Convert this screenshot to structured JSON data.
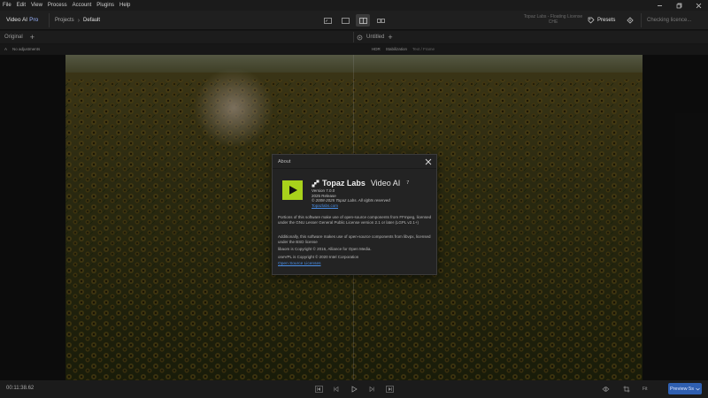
{
  "menu": [
    "File",
    "Edit",
    "View",
    "Process",
    "Account",
    "Plugins",
    "Help"
  ],
  "window_controls": {
    "minimize": "minimize-icon",
    "restore": "restore-icon",
    "close": "close-icon"
  },
  "app": {
    "name": "Video AI",
    "tier": "Pro"
  },
  "breadcrumb": {
    "root": "Projects",
    "current": "Default"
  },
  "view_modes": [
    "single-view-icon",
    "full-view-icon",
    "split-view-icon",
    "side-by-side-icon"
  ],
  "view_active": 2,
  "license_status": "Topaz Labs - Floating License\nCHE",
  "presets_label": "Presets",
  "checking_label": "Checking licence...",
  "left_panel": {
    "tab": "Original"
  },
  "right_panel": {
    "tab": "Untitled"
  },
  "info_left": {
    "a": "A",
    "adjustments": "No adjustments"
  },
  "info_right": {
    "hdr": "HDR",
    "stabilization": "Stabilization",
    "detail": "Text / Frame"
  },
  "about": {
    "title": "About",
    "brand": "Topaz Labs",
    "product": "Video AI",
    "major": "7",
    "version": "Version 7.0.0",
    "release": "2025 Release",
    "copyright": "© 2008-2025 Topaz Labs. All rights reserved",
    "site": "Topazlabs.com",
    "ffmpeg": "Portions of this software make use of open-source components from FFmpeg, licensed under the GNU Lesser General Public License version 2.1 or later (LGPL v2.1+)",
    "libvpx": "Additionally, this software makes use of open-source components from libvpx, licensed under the BSD license",
    "libaom": "libaom is Copyright © 2016, Alliance for Open Media.",
    "onevpl": "oneVPL is Copyright © 2020 Intel Corporation",
    "oss_link": "Open Source Licenses"
  },
  "timeline": {
    "timecode": "00:11:38.62",
    "fit": "Fit",
    "preview": "Preview 5s"
  },
  "colors": {
    "accent": "#a8d21b",
    "link": "#4a8fe8",
    "primary_button": "#2f5fb0"
  }
}
